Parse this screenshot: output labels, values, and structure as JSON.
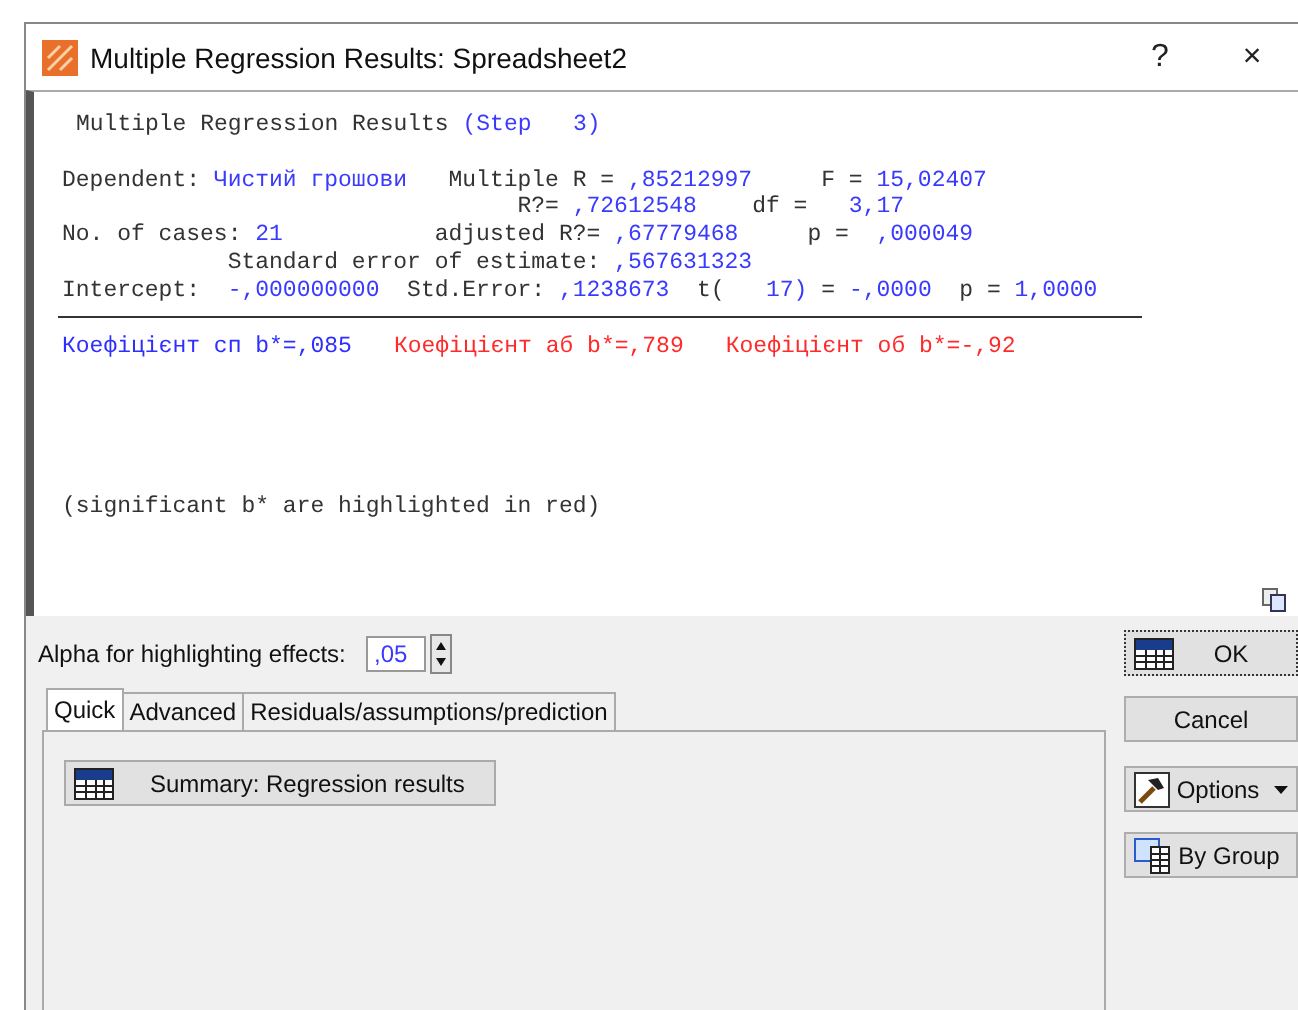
{
  "window": {
    "title": "Multiple Regression Results: Spreadsheet2",
    "help": "?",
    "close": "×"
  },
  "results": {
    "heading": [
      {
        "text": "Multiple Regression Results ",
        "kind": "label"
      },
      {
        "text": "(Step   3)",
        "kind": "value"
      }
    ],
    "lines": [
      {
        "segments": [
          {
            "text": "Dependent: ",
            "kind": "label"
          },
          {
            "text": "Чистий грошови",
            "kind": "value"
          },
          {
            "text": "   Multiple R = ",
            "kind": "label"
          },
          {
            "text": ",85212997",
            "kind": "value"
          },
          {
            "text": "     F = ",
            "kind": "label"
          },
          {
            "text": "15,02407",
            "kind": "value"
          }
        ]
      },
      {
        "segments": [
          {
            "text": "                                 R?= ",
            "kind": "label"
          },
          {
            "text": ",72612548",
            "kind": "value"
          },
          {
            "text": "    df = ",
            "kind": "label"
          },
          {
            "text": "  3,17",
            "kind": "value"
          }
        ]
      },
      {
        "segments": [
          {
            "text": "No. of cases: ",
            "kind": "label"
          },
          {
            "text": "21",
            "kind": "value"
          },
          {
            "text": "           adjusted R?= ",
            "kind": "label"
          },
          {
            "text": ",67779468",
            "kind": "value"
          },
          {
            "text": "     p = ",
            "kind": "label"
          },
          {
            "text": " ,000049",
            "kind": "value"
          }
        ]
      },
      {
        "segments": [
          {
            "text": "            Standard error of estimate: ",
            "kind": "label"
          },
          {
            "text": ",567631323",
            "kind": "value"
          }
        ]
      },
      {
        "segments": [
          {
            "text": "Intercept: ",
            "kind": "label"
          },
          {
            "text": " -,000000000",
            "kind": "value"
          },
          {
            "text": "  Std.Error: ",
            "kind": "label"
          },
          {
            "text": ",1238673",
            "kind": "value"
          },
          {
            "text": "  t(",
            "kind": "label"
          },
          {
            "text": "   17)",
            "kind": "value"
          },
          {
            "text": " = ",
            "kind": "label"
          },
          {
            "text": "-,0000",
            "kind": "value"
          },
          {
            "text": "  p = ",
            "kind": "label"
          },
          {
            "text": "1,0000",
            "kind": "value"
          }
        ]
      }
    ],
    "coefficients": [
      {
        "text": "Коефіцієнт сп b*=,085",
        "significant": false
      },
      {
        "text": "Коефіцієнт аб b*=,789",
        "significant": true
      },
      {
        "text": "Коефіцієнт об b*=-,92",
        "significant": true
      }
    ],
    "note": "(significant b* are highlighted in red)"
  },
  "alpha": {
    "label": "Alpha for highlighting effects:",
    "value": ",05"
  },
  "tabs": [
    {
      "label": "Quick",
      "selected": true
    },
    {
      "label": "Advanced",
      "selected": false
    },
    {
      "label": "Residuals/assumptions/prediction",
      "selected": false
    }
  ],
  "quick_buttons": [
    {
      "label": "Summary:  Regression results"
    }
  ],
  "side_buttons": [
    {
      "label": "OK",
      "kind": "table",
      "default": true
    },
    {
      "label": "Cancel",
      "kind": "plain",
      "default": false
    },
    {
      "label": "Options",
      "kind": "options",
      "default": false
    },
    {
      "label": "By Group",
      "kind": "group",
      "default": false
    }
  ]
}
